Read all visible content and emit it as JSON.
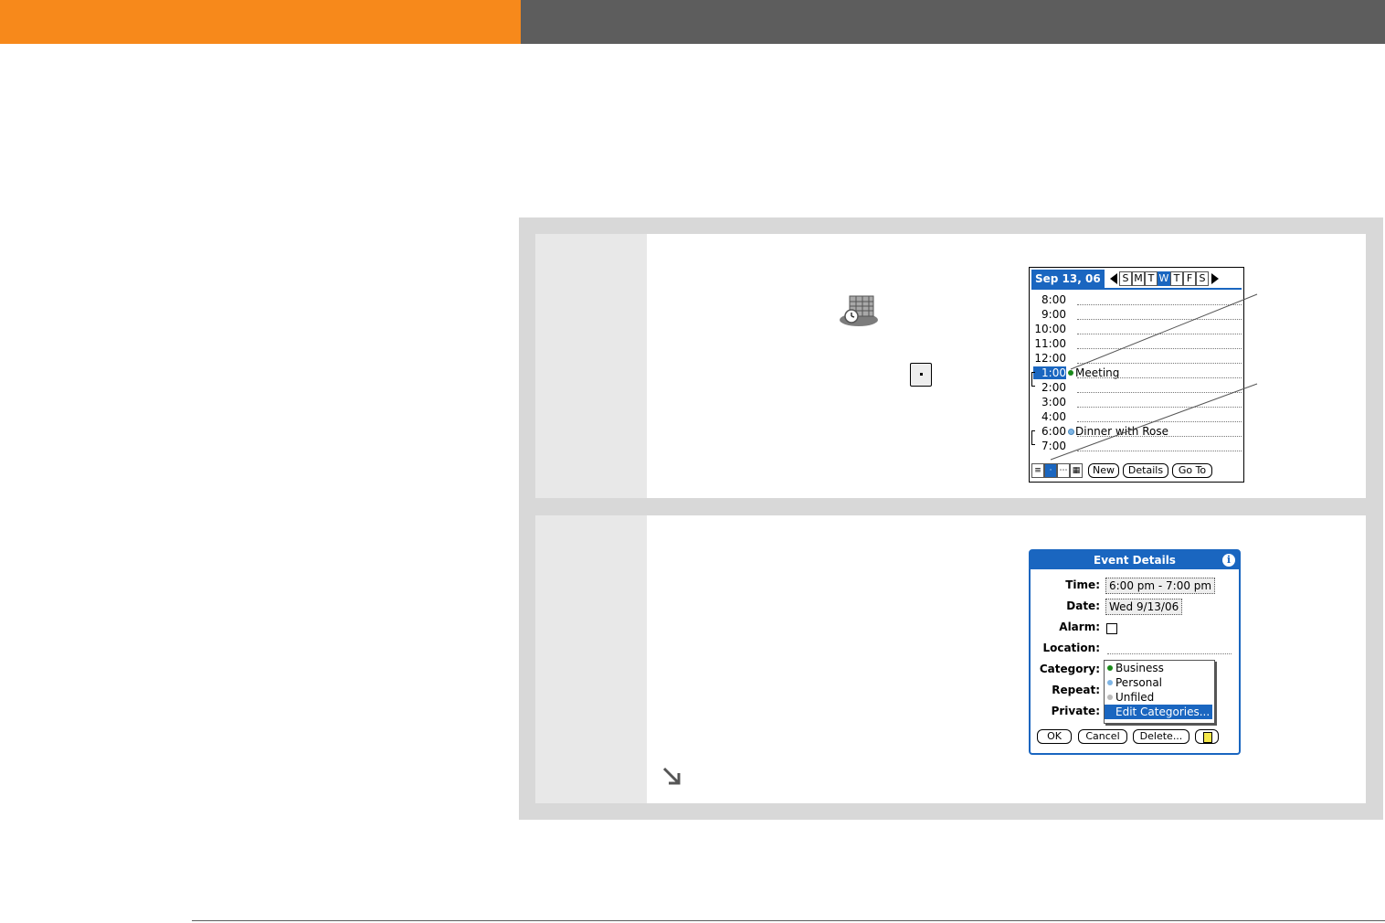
{
  "header": {
    "orange": "#f7891b",
    "gray": "#5d5d5d"
  },
  "icons": {
    "app_icon": "calendar-app-icon",
    "day_view": "day-view-icon",
    "continue": "continue-arrow-icon"
  },
  "screen1": {
    "date_label": "Sep 13, 06",
    "days": [
      "S",
      "M",
      "T",
      "W",
      "T",
      "F",
      "S"
    ],
    "selected_day_index": 3,
    "hours": [
      "8:00",
      "9:00",
      "10:00",
      "11:00",
      "12:00",
      "1:00",
      "2:00",
      "3:00",
      "4:00",
      "6:00",
      "7:00"
    ],
    "selected_hour": "1:00",
    "events": [
      {
        "time": "1:00",
        "title": "Meeting",
        "dot_color": "#1a8a1a"
      },
      {
        "time": "6:00",
        "title": "Dinner with Rose",
        "dot_color": "#7fb6e6"
      }
    ],
    "buttons": {
      "new": "New",
      "details": "Details",
      "goto": "Go To"
    },
    "view_buttons": [
      "list",
      "day",
      "week",
      "month"
    ]
  },
  "screen2": {
    "title": "Event Details",
    "labels": {
      "time": "Time:",
      "date": "Date:",
      "alarm": "Alarm:",
      "location": "Location:",
      "category": "Category:",
      "repeat": "Repeat:",
      "private": "Private:"
    },
    "values": {
      "time": "6:00 pm - 7:00 pm",
      "date": "Wed 9/13/06"
    },
    "category_options": [
      {
        "label": "Business",
        "dot_color": "#1a8a1a"
      },
      {
        "label": "Personal",
        "dot_color": "#7fb6e6"
      },
      {
        "label": "Unfiled",
        "dot_color": "#bbbbbb"
      },
      {
        "label": "Edit Categories...",
        "dot_color": ""
      }
    ],
    "buttons": {
      "ok": "OK",
      "cancel": "Cancel",
      "delete": "Delete..."
    }
  }
}
